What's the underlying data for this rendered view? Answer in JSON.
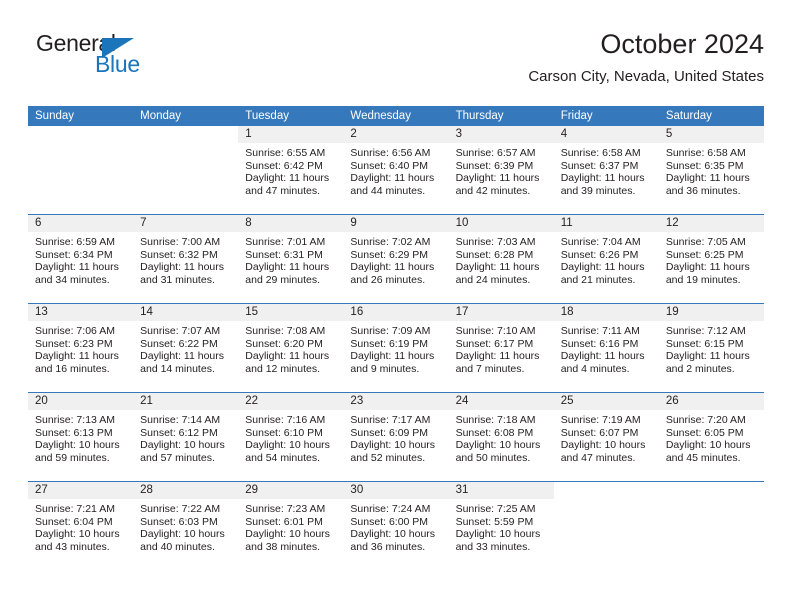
{
  "brand": {
    "name_top": "General",
    "name_bottom": "Blue",
    "triangle_icon": "blue-triangle-icon",
    "color_dark": "#231f20",
    "color_blue": "#1b75bb"
  },
  "header": {
    "title": "October 2024",
    "subtitle": "Carson City, Nevada, United States"
  },
  "theme": {
    "header_blue": "#3578bc",
    "daynum_band": "#f0f0f0",
    "text": "#231f20",
    "background": "#ffffff"
  },
  "weekday_headers": [
    "Sunday",
    "Monday",
    "Tuesday",
    "Wednesday",
    "Thursday",
    "Friday",
    "Saturday"
  ],
  "weeks": [
    [
      {
        "day": "",
        "blank": true,
        "sunrise": "",
        "sunset": "",
        "daylight_line1": "",
        "daylight_line2": ""
      },
      {
        "day": "",
        "blank": true,
        "sunrise": "",
        "sunset": "",
        "daylight_line1": "",
        "daylight_line2": ""
      },
      {
        "day": "1",
        "sunrise": "Sunrise: 6:55 AM",
        "sunset": "Sunset: 6:42 PM",
        "daylight_line1": "Daylight: 11 hours",
        "daylight_line2": "and 47 minutes."
      },
      {
        "day": "2",
        "sunrise": "Sunrise: 6:56 AM",
        "sunset": "Sunset: 6:40 PM",
        "daylight_line1": "Daylight: 11 hours",
        "daylight_line2": "and 44 minutes."
      },
      {
        "day": "3",
        "sunrise": "Sunrise: 6:57 AM",
        "sunset": "Sunset: 6:39 PM",
        "daylight_line1": "Daylight: 11 hours",
        "daylight_line2": "and 42 minutes."
      },
      {
        "day": "4",
        "sunrise": "Sunrise: 6:58 AM",
        "sunset": "Sunset: 6:37 PM",
        "daylight_line1": "Daylight: 11 hours",
        "daylight_line2": "and 39 minutes."
      },
      {
        "day": "5",
        "sunrise": "Sunrise: 6:58 AM",
        "sunset": "Sunset: 6:35 PM",
        "daylight_line1": "Daylight: 11 hours",
        "daylight_line2": "and 36 minutes."
      }
    ],
    [
      {
        "day": "6",
        "sunrise": "Sunrise: 6:59 AM",
        "sunset": "Sunset: 6:34 PM",
        "daylight_line1": "Daylight: 11 hours",
        "daylight_line2": "and 34 minutes."
      },
      {
        "day": "7",
        "sunrise": "Sunrise: 7:00 AM",
        "sunset": "Sunset: 6:32 PM",
        "daylight_line1": "Daylight: 11 hours",
        "daylight_line2": "and 31 minutes."
      },
      {
        "day": "8",
        "sunrise": "Sunrise: 7:01 AM",
        "sunset": "Sunset: 6:31 PM",
        "daylight_line1": "Daylight: 11 hours",
        "daylight_line2": "and 29 minutes."
      },
      {
        "day": "9",
        "sunrise": "Sunrise: 7:02 AM",
        "sunset": "Sunset: 6:29 PM",
        "daylight_line1": "Daylight: 11 hours",
        "daylight_line2": "and 26 minutes."
      },
      {
        "day": "10",
        "sunrise": "Sunrise: 7:03 AM",
        "sunset": "Sunset: 6:28 PM",
        "daylight_line1": "Daylight: 11 hours",
        "daylight_line2": "and 24 minutes."
      },
      {
        "day": "11",
        "sunrise": "Sunrise: 7:04 AM",
        "sunset": "Sunset: 6:26 PM",
        "daylight_line1": "Daylight: 11 hours",
        "daylight_line2": "and 21 minutes."
      },
      {
        "day": "12",
        "sunrise": "Sunrise: 7:05 AM",
        "sunset": "Sunset: 6:25 PM",
        "daylight_line1": "Daylight: 11 hours",
        "daylight_line2": "and 19 minutes."
      }
    ],
    [
      {
        "day": "13",
        "sunrise": "Sunrise: 7:06 AM",
        "sunset": "Sunset: 6:23 PM",
        "daylight_line1": "Daylight: 11 hours",
        "daylight_line2": "and 16 minutes."
      },
      {
        "day": "14",
        "sunrise": "Sunrise: 7:07 AM",
        "sunset": "Sunset: 6:22 PM",
        "daylight_line1": "Daylight: 11 hours",
        "daylight_line2": "and 14 minutes."
      },
      {
        "day": "15",
        "sunrise": "Sunrise: 7:08 AM",
        "sunset": "Sunset: 6:20 PM",
        "daylight_line1": "Daylight: 11 hours",
        "daylight_line2": "and 12 minutes."
      },
      {
        "day": "16",
        "sunrise": "Sunrise: 7:09 AM",
        "sunset": "Sunset: 6:19 PM",
        "daylight_line1": "Daylight: 11 hours",
        "daylight_line2": "and 9 minutes."
      },
      {
        "day": "17",
        "sunrise": "Sunrise: 7:10 AM",
        "sunset": "Sunset: 6:17 PM",
        "daylight_line1": "Daylight: 11 hours",
        "daylight_line2": "and 7 minutes."
      },
      {
        "day": "18",
        "sunrise": "Sunrise: 7:11 AM",
        "sunset": "Sunset: 6:16 PM",
        "daylight_line1": "Daylight: 11 hours",
        "daylight_line2": "and 4 minutes."
      },
      {
        "day": "19",
        "sunrise": "Sunrise: 7:12 AM",
        "sunset": "Sunset: 6:15 PM",
        "daylight_line1": "Daylight: 11 hours",
        "daylight_line2": "and 2 minutes."
      }
    ],
    [
      {
        "day": "20",
        "sunrise": "Sunrise: 7:13 AM",
        "sunset": "Sunset: 6:13 PM",
        "daylight_line1": "Daylight: 10 hours",
        "daylight_line2": "and 59 minutes."
      },
      {
        "day": "21",
        "sunrise": "Sunrise: 7:14 AM",
        "sunset": "Sunset: 6:12 PM",
        "daylight_line1": "Daylight: 10 hours",
        "daylight_line2": "and 57 minutes."
      },
      {
        "day": "22",
        "sunrise": "Sunrise: 7:16 AM",
        "sunset": "Sunset: 6:10 PM",
        "daylight_line1": "Daylight: 10 hours",
        "daylight_line2": "and 54 minutes."
      },
      {
        "day": "23",
        "sunrise": "Sunrise: 7:17 AM",
        "sunset": "Sunset: 6:09 PM",
        "daylight_line1": "Daylight: 10 hours",
        "daylight_line2": "and 52 minutes."
      },
      {
        "day": "24",
        "sunrise": "Sunrise: 7:18 AM",
        "sunset": "Sunset: 6:08 PM",
        "daylight_line1": "Daylight: 10 hours",
        "daylight_line2": "and 50 minutes."
      },
      {
        "day": "25",
        "sunrise": "Sunrise: 7:19 AM",
        "sunset": "Sunset: 6:07 PM",
        "daylight_line1": "Daylight: 10 hours",
        "daylight_line2": "and 47 minutes."
      },
      {
        "day": "26",
        "sunrise": "Sunrise: 7:20 AM",
        "sunset": "Sunset: 6:05 PM",
        "daylight_line1": "Daylight: 10 hours",
        "daylight_line2": "and 45 minutes."
      }
    ],
    [
      {
        "day": "27",
        "sunrise": "Sunrise: 7:21 AM",
        "sunset": "Sunset: 6:04 PM",
        "daylight_line1": "Daylight: 10 hours",
        "daylight_line2": "and 43 minutes."
      },
      {
        "day": "28",
        "sunrise": "Sunrise: 7:22 AM",
        "sunset": "Sunset: 6:03 PM",
        "daylight_line1": "Daylight: 10 hours",
        "daylight_line2": "and 40 minutes."
      },
      {
        "day": "29",
        "sunrise": "Sunrise: 7:23 AM",
        "sunset": "Sunset: 6:01 PM",
        "daylight_line1": "Daylight: 10 hours",
        "daylight_line2": "and 38 minutes."
      },
      {
        "day": "30",
        "sunrise": "Sunrise: 7:24 AM",
        "sunset": "Sunset: 6:00 PM",
        "daylight_line1": "Daylight: 10 hours",
        "daylight_line2": "and 36 minutes."
      },
      {
        "day": "31",
        "sunrise": "Sunrise: 7:25 AM",
        "sunset": "Sunset: 5:59 PM",
        "daylight_line1": "Daylight: 10 hours",
        "daylight_line2": "and 33 minutes."
      },
      {
        "day": "",
        "blank": true,
        "sunrise": "",
        "sunset": "",
        "daylight_line1": "",
        "daylight_line2": ""
      },
      {
        "day": "",
        "blank": true,
        "sunrise": "",
        "sunset": "",
        "daylight_line1": "",
        "daylight_line2": ""
      }
    ]
  ]
}
